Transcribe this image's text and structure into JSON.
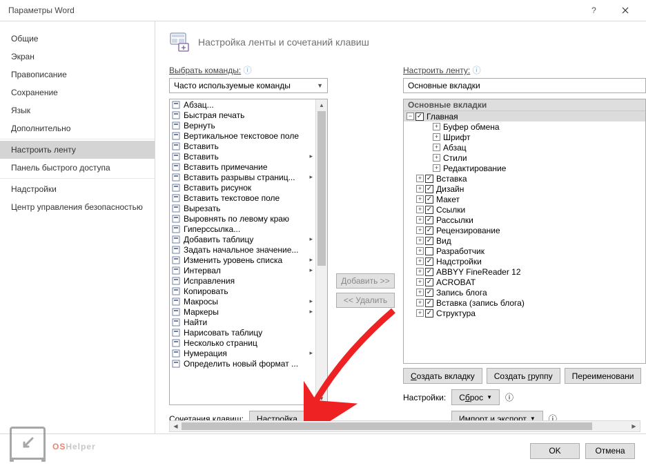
{
  "window": {
    "title": "Параметры Word"
  },
  "sidebar": {
    "items": [
      {
        "label": "Общие"
      },
      {
        "label": "Экран"
      },
      {
        "label": "Правописание"
      },
      {
        "label": "Сохранение"
      },
      {
        "label": "Язык"
      },
      {
        "label": "Дополнительно"
      },
      {
        "label": "Настроить ленту",
        "selected": true
      },
      {
        "label": "Панель быстрого доступа"
      },
      {
        "label": "Надстройки"
      },
      {
        "label": "Центр управления безопасностью"
      }
    ],
    "separators_after": [
      5,
      7
    ]
  },
  "header": {
    "title": "Настройка ленты и сочетаний клавиш"
  },
  "left": {
    "label": "Выбрать команды:",
    "combo": "Часто используемые команды",
    "commands": [
      {
        "label": "Абзац...",
        "arrow": false
      },
      {
        "label": "Быстрая печать"
      },
      {
        "label": "Вернуть"
      },
      {
        "label": "Вертикальное текстовое поле"
      },
      {
        "label": "Вставить"
      },
      {
        "label": "Вставить",
        "arrow": true
      },
      {
        "label": "Вставить примечание"
      },
      {
        "label": "Вставить разрывы страниц...",
        "arrow": true
      },
      {
        "label": "Вставить рисунок"
      },
      {
        "label": "Вставить текстовое поле"
      },
      {
        "label": "Вырезать"
      },
      {
        "label": "Выровнять по левому краю"
      },
      {
        "label": "Гиперссылка..."
      },
      {
        "label": "Добавить таблицу",
        "arrow": true
      },
      {
        "label": "Задать начальное значение..."
      },
      {
        "label": "Изменить уровень списка",
        "arrow": true
      },
      {
        "label": "Интервал",
        "arrow": true
      },
      {
        "label": "Исправления"
      },
      {
        "label": "Копировать"
      },
      {
        "label": "Макросы",
        "arrow": true
      },
      {
        "label": "Маркеры",
        "arrow": true
      },
      {
        "label": "Найти"
      },
      {
        "label": "Нарисовать таблицу"
      },
      {
        "label": "Несколько страниц"
      },
      {
        "label": "Нумерация",
        "arrow": true
      },
      {
        "label": "Определить новый формат ..."
      }
    ]
  },
  "mid": {
    "add": "Добавить >>",
    "remove": "<< Удалить"
  },
  "right": {
    "label": "Настроить ленту:",
    "combo": "Основные вкладки",
    "tree_header": "Основные вкладки",
    "root": {
      "label": "Главная",
      "checked": true,
      "expanded": true,
      "selected": true
    },
    "root_children": [
      {
        "label": "Буфер обмена"
      },
      {
        "label": "Шрифт"
      },
      {
        "label": "Абзац"
      },
      {
        "label": "Стили"
      },
      {
        "label": "Редактирование"
      }
    ],
    "tabs": [
      {
        "label": "Вставка",
        "checked": true
      },
      {
        "label": "Дизайн",
        "checked": true
      },
      {
        "label": "Макет",
        "checked": true
      },
      {
        "label": "Ссылки",
        "checked": true
      },
      {
        "label": "Рассылки",
        "checked": true
      },
      {
        "label": "Рецензирование",
        "checked": true
      },
      {
        "label": "Вид",
        "checked": true
      },
      {
        "label": "Разработчик",
        "checked": false
      },
      {
        "label": "Надстройки",
        "checked": true
      },
      {
        "label": "ABBYY FineReader 12",
        "checked": true
      },
      {
        "label": "ACROBAT",
        "checked": true
      },
      {
        "label": "Запись блога",
        "checked": true
      },
      {
        "label": "Вставка (запись блога)",
        "checked": true
      },
      {
        "label": "Структура",
        "checked": true
      }
    ],
    "buttons": {
      "new_tab": "Создать вкладку",
      "new_group": "Создать группу",
      "rename": "Переименовани"
    },
    "settings_label": "Настройки:",
    "reset": "Сброс",
    "import": "Импорт и экспорт"
  },
  "shortcuts": {
    "label": "Сочетания клавиш:",
    "button": "Настройка..."
  },
  "footer": {
    "ok": "OK",
    "cancel": "Отмена"
  },
  "logo": {
    "os": "OS",
    "helper": "Helper"
  }
}
